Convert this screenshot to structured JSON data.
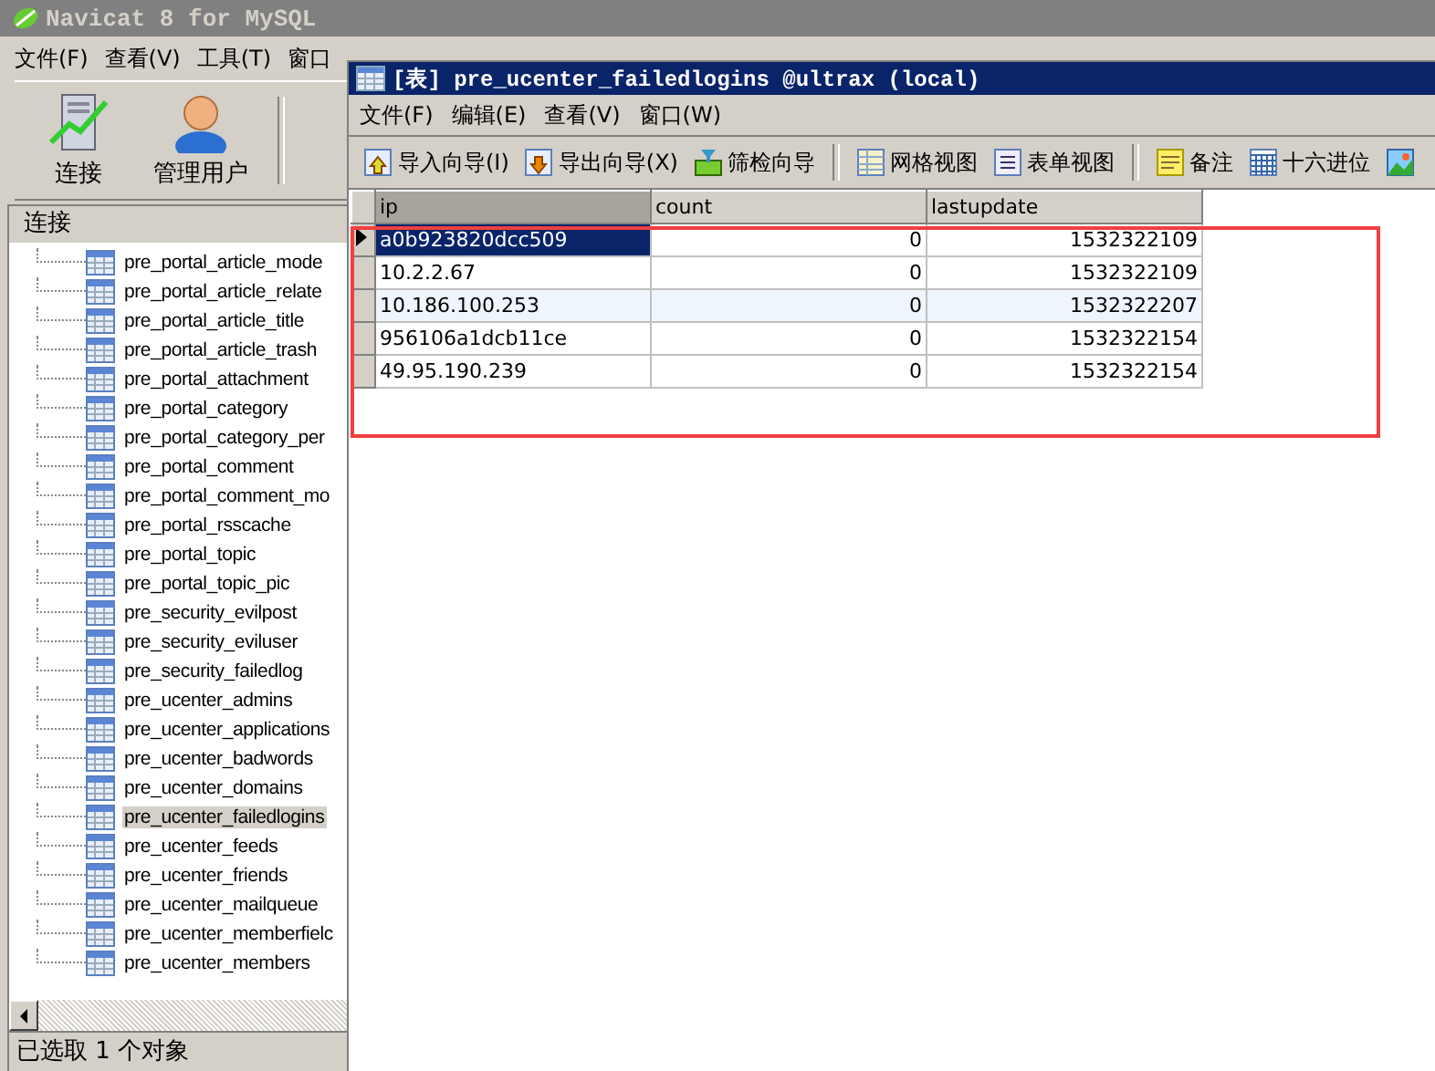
{
  "window": {
    "title": "Navicat 8 for MySQL"
  },
  "menu": [
    "文件(F)",
    "查看(V)",
    "工具(T)",
    "窗口"
  ],
  "toolbar": [
    {
      "label": "连接",
      "kind": "server"
    },
    {
      "label": "管理用户",
      "kind": "user"
    }
  ],
  "sidebar": {
    "header": "连接",
    "items": [
      {
        "label": "pre_portal_article_mode",
        "selected": false
      },
      {
        "label": "pre_portal_article_relate",
        "selected": false
      },
      {
        "label": "pre_portal_article_title",
        "selected": false
      },
      {
        "label": "pre_portal_article_trash",
        "selected": false
      },
      {
        "label": "pre_portal_attachment",
        "selected": false
      },
      {
        "label": "pre_portal_category",
        "selected": false
      },
      {
        "label": "pre_portal_category_per",
        "selected": false
      },
      {
        "label": "pre_portal_comment",
        "selected": false
      },
      {
        "label": "pre_portal_comment_mo",
        "selected": false
      },
      {
        "label": "pre_portal_rsscache",
        "selected": false
      },
      {
        "label": "pre_portal_topic",
        "selected": false
      },
      {
        "label": "pre_portal_topic_pic",
        "selected": false
      },
      {
        "label": "pre_security_evilpost",
        "selected": false
      },
      {
        "label": "pre_security_eviluser",
        "selected": false
      },
      {
        "label": "pre_security_failedlog",
        "selected": false
      },
      {
        "label": "pre_ucenter_admins",
        "selected": false
      },
      {
        "label": "pre_ucenter_applications",
        "selected": false
      },
      {
        "label": "pre_ucenter_badwords",
        "selected": false
      },
      {
        "label": "pre_ucenter_domains",
        "selected": false
      },
      {
        "label": "pre_ucenter_failedlogins",
        "selected": true
      },
      {
        "label": "pre_ucenter_feeds",
        "selected": false
      },
      {
        "label": "pre_ucenter_friends",
        "selected": false
      },
      {
        "label": "pre_ucenter_mailqueue",
        "selected": false
      },
      {
        "label": "pre_ucenter_memberfielc",
        "selected": false
      },
      {
        "label": "pre_ucenter_members",
        "selected": false
      }
    ]
  },
  "status_bar": "已选取 1 个对象",
  "table_window": {
    "title": "[表] pre_ucenter_failedlogins @ultrax (local)",
    "menu": [
      "文件(F)",
      "编辑(E)",
      "查看(V)",
      "窗口(W)"
    ],
    "toolbar": [
      {
        "label": "导入向导(I)",
        "kind": "import"
      },
      {
        "label": "导出向导(X)",
        "kind": "export"
      },
      {
        "label": "筛检向导",
        "kind": "filter"
      },
      {
        "kind": "separator"
      },
      {
        "label": "网格视图",
        "kind": "grid"
      },
      {
        "label": "表单视图",
        "kind": "form"
      },
      {
        "kind": "separator"
      },
      {
        "label": "备注",
        "kind": "memo"
      },
      {
        "label": "十六进位",
        "kind": "hex"
      },
      {
        "kind": "image"
      }
    ],
    "table": {
      "columns": [
        {
          "label": "ip",
          "selected": true
        },
        {
          "label": "count",
          "selected": false
        },
        {
          "label": "lastupdate",
          "selected": false
        }
      ],
      "rows": [
        {
          "cells": [
            "a0b923820dcc509",
            "0",
            "1532322109"
          ],
          "selected": true,
          "hovered": false
        },
        {
          "cells": [
            "10.2.2.67",
            "0",
            "1532322109"
          ],
          "selected": false,
          "hovered": false
        },
        {
          "cells": [
            "10.186.100.253",
            "0",
            "1532322207"
          ],
          "selected": false,
          "hovered": true
        },
        {
          "cells": [
            "956106a1dcb11ce",
            "0",
            "1532322154"
          ],
          "selected": false,
          "hovered": false
        },
        {
          "cells": [
            "49.95.190.239",
            "0",
            "1532322154"
          ],
          "selected": false,
          "hovered": false
        }
      ]
    }
  }
}
